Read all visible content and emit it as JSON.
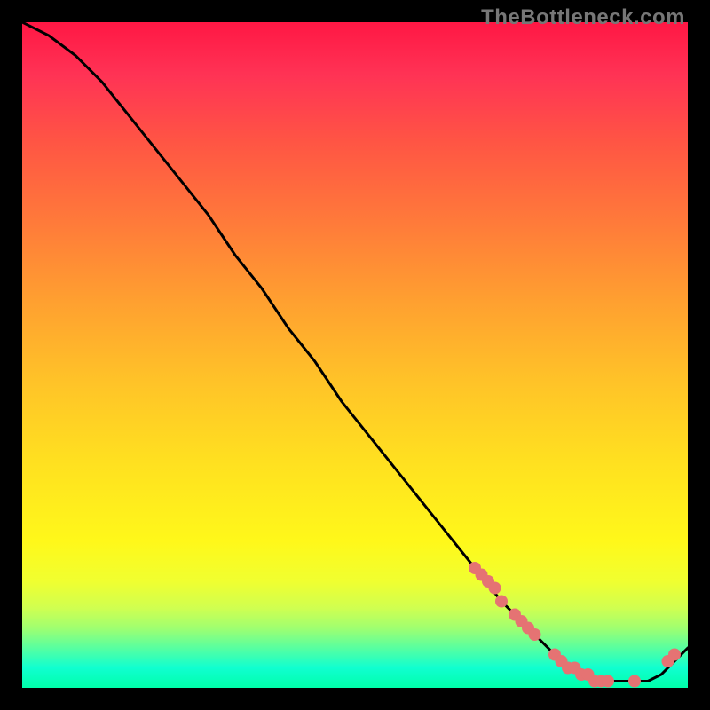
{
  "watermark": "TheBottleneck.com",
  "chart_data": {
    "type": "line",
    "title": "",
    "xlabel": "",
    "ylabel": "",
    "xlim": [
      0,
      100
    ],
    "ylim": [
      0,
      100
    ],
    "grid": false,
    "legend": false,
    "background_gradient": {
      "direction": "vertical",
      "stops": [
        {
          "pos": 0.0,
          "color": "#ff1744"
        },
        {
          "pos": 0.5,
          "color": "#ffd020"
        },
        {
          "pos": 0.85,
          "color": "#eaff30"
        },
        {
          "pos": 1.0,
          "color": "#00ffaa"
        }
      ]
    },
    "series": [
      {
        "name": "bottleneck-curve",
        "color": "#000000",
        "type": "line",
        "x": [
          0,
          4,
          8,
          12,
          16,
          20,
          24,
          28,
          32,
          36,
          40,
          44,
          48,
          52,
          56,
          60,
          64,
          68,
          72,
          76,
          80,
          82,
          84,
          86,
          88,
          90,
          92,
          94,
          96,
          98,
          100
        ],
        "values": [
          100,
          98,
          95,
          91,
          86,
          81,
          76,
          71,
          65,
          60,
          54,
          49,
          43,
          38,
          33,
          28,
          23,
          18,
          13,
          9,
          5,
          3,
          2,
          1,
          1,
          1,
          1,
          1,
          2,
          4,
          6
        ]
      },
      {
        "name": "data-points",
        "color": "#e57373",
        "type": "scatter",
        "marker_radius": 7,
        "x": [
          68,
          69,
          70,
          71,
          72,
          74,
          75,
          76,
          77,
          80,
          81,
          82,
          83,
          84,
          85,
          86,
          87,
          88,
          92,
          97,
          98
        ],
        "values": [
          18,
          17,
          16,
          15,
          13,
          11,
          10,
          9,
          8,
          5,
          4,
          3,
          3,
          2,
          2,
          1,
          1,
          1,
          1,
          4,
          5
        ]
      }
    ]
  }
}
